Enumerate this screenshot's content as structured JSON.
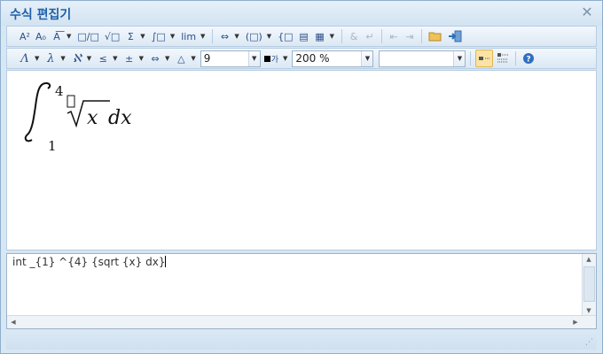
{
  "window": {
    "title": "수식 편집기"
  },
  "toolbar1": {
    "buttons": [
      {
        "name": "superscript",
        "label": "A²"
      },
      {
        "name": "subscript",
        "label": "A₀"
      },
      {
        "name": "over-under",
        "label": "A͞"
      },
      {
        "name": "fraction",
        "label": "□/□"
      },
      {
        "name": "root",
        "label": "√□"
      },
      {
        "name": "sum",
        "label": "Σ"
      },
      {
        "name": "integral",
        "label": "∫□"
      },
      {
        "name": "limit",
        "label": "lim"
      },
      {
        "name": "arrow-decor",
        "label": "⇔"
      },
      {
        "name": "brackets",
        "label": "(□)"
      },
      {
        "name": "cases",
        "label": "{□"
      },
      {
        "name": "pile",
        "label": "▤"
      },
      {
        "name": "matrix",
        "label": "▦"
      },
      {
        "name": "ampersand",
        "label": "&"
      },
      {
        "name": "newline",
        "label": "↵"
      },
      {
        "name": "prev",
        "label": "⇤"
      },
      {
        "name": "next",
        "label": "⇥"
      },
      {
        "name": "open",
        "label": "📂"
      },
      {
        "name": "insert",
        "label": "⇨"
      }
    ]
  },
  "toolbar2": {
    "symbols": [
      {
        "name": "greek-upper",
        "label": "Λ"
      },
      {
        "name": "greek-lower",
        "label": "λ"
      },
      {
        "name": "hebrew",
        "label": "ℵ"
      },
      {
        "name": "relation",
        "label": "≤"
      },
      {
        "name": "operator",
        "label": "±"
      },
      {
        "name": "arrows",
        "label": "⇔"
      },
      {
        "name": "misc",
        "label": "△"
      }
    ],
    "font_size": "9",
    "color_label": "가",
    "zoom": "200 %",
    "font_name": ""
  },
  "formula": {
    "script": "int _{1} ^{4} {sqrt {x} dx}",
    "lower_limit": "1",
    "upper_limit": "4",
    "radicand": "x",
    "differential": "dx"
  }
}
